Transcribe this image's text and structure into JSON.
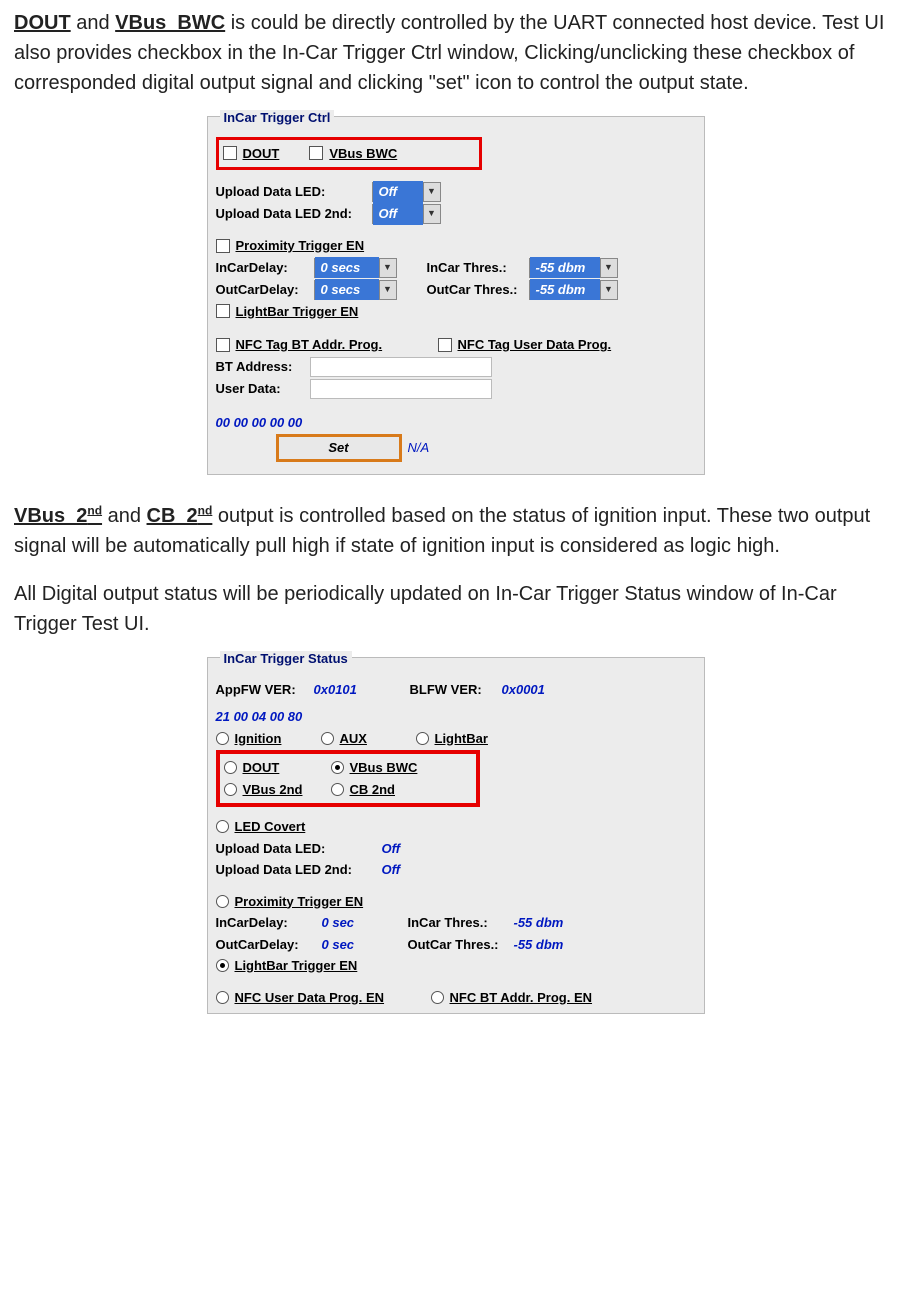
{
  "para1_pre": "",
  "p1_bold1": "DOUT",
  "p1_mid": " and ",
  "p1_bold2": "VBus_BWC",
  "p1_rest": " is could be directly controlled by the UART connected host device. Test UI also provides checkbox in the In-Car Trigger Ctrl window, Clicking/unclicking these checkbox of corresponded digital output signal and clicking \"set\" icon to control the output state.",
  "ctrl": {
    "legend": "InCar Trigger Ctrl",
    "dout": "DOUT",
    "vbusbwc": "VBus BWC",
    "uploadLed": "Upload Data LED:",
    "uploadLed2": "Upload Data LED 2nd:",
    "off": "Off",
    "proxEn": "Proximity Trigger EN",
    "inCarDelay": "InCarDelay:",
    "outCarDelay": "OutCarDelay:",
    "inCarThres": "InCar Thres.:",
    "outCarThres": "OutCar Thres.:",
    "zeroSec": "0 secs",
    "dbm": "-55 dbm",
    "lightBarEn": "LightBar Trigger EN",
    "nfcBtProg": "NFC Tag BT Addr. Prog.",
    "nfcUserProg": "NFC Tag User Data Prog.",
    "btAddr": "BT Address:",
    "userData": "User Data:",
    "zeros": "00 00 00 00 00",
    "set": "Set",
    "na": "N/A"
  },
  "p2_b1": "VBus_2",
  "p2_sup": "nd",
  "p2_mid": " and ",
  "p2_b2": "CB_2",
  "p2_rest": " output is controlled based on the status of ignition input. These two output signal will be automatically pull high if state of ignition input is considered as logic high.",
  "p3": "All Digital output status will be periodically updated on In-Car Trigger Status window of In-Car Trigger Test UI.",
  "status": {
    "legend": "InCar Trigger Status",
    "appfw": "AppFW VER:",
    "appfwv": "0x0101",
    "blfw": "BLFW VER:",
    "blfwv": "0x0001",
    "hex": "21 00 04 00 80",
    "ign": "Ignition",
    "aux": "AUX",
    "lightbar": "LightBar",
    "dout": "DOUT",
    "vbusbwc": "VBus BWC",
    "vbus2": "VBus 2nd",
    "cb2": "CB 2nd",
    "ledCovert": "LED Covert",
    "uploadLed": "Upload Data LED:",
    "uploadLed2": "Upload Data LED 2nd:",
    "off": "Off",
    "proxEn": "Proximity Trigger EN",
    "inCarDelay": "InCarDelay:",
    "outCarDelay": "OutCarDelay:",
    "inCarThres": "InCar Thres.:",
    "outCarThres": "OutCar Thres.:",
    "sec": "0 sec",
    "dbm": "-55 dbm",
    "lightBarEn": "LightBar Trigger EN",
    "nfcUser": "NFC User Data Prog. EN",
    "nfcBt": "NFC BT Addr. Prog. EN"
  }
}
